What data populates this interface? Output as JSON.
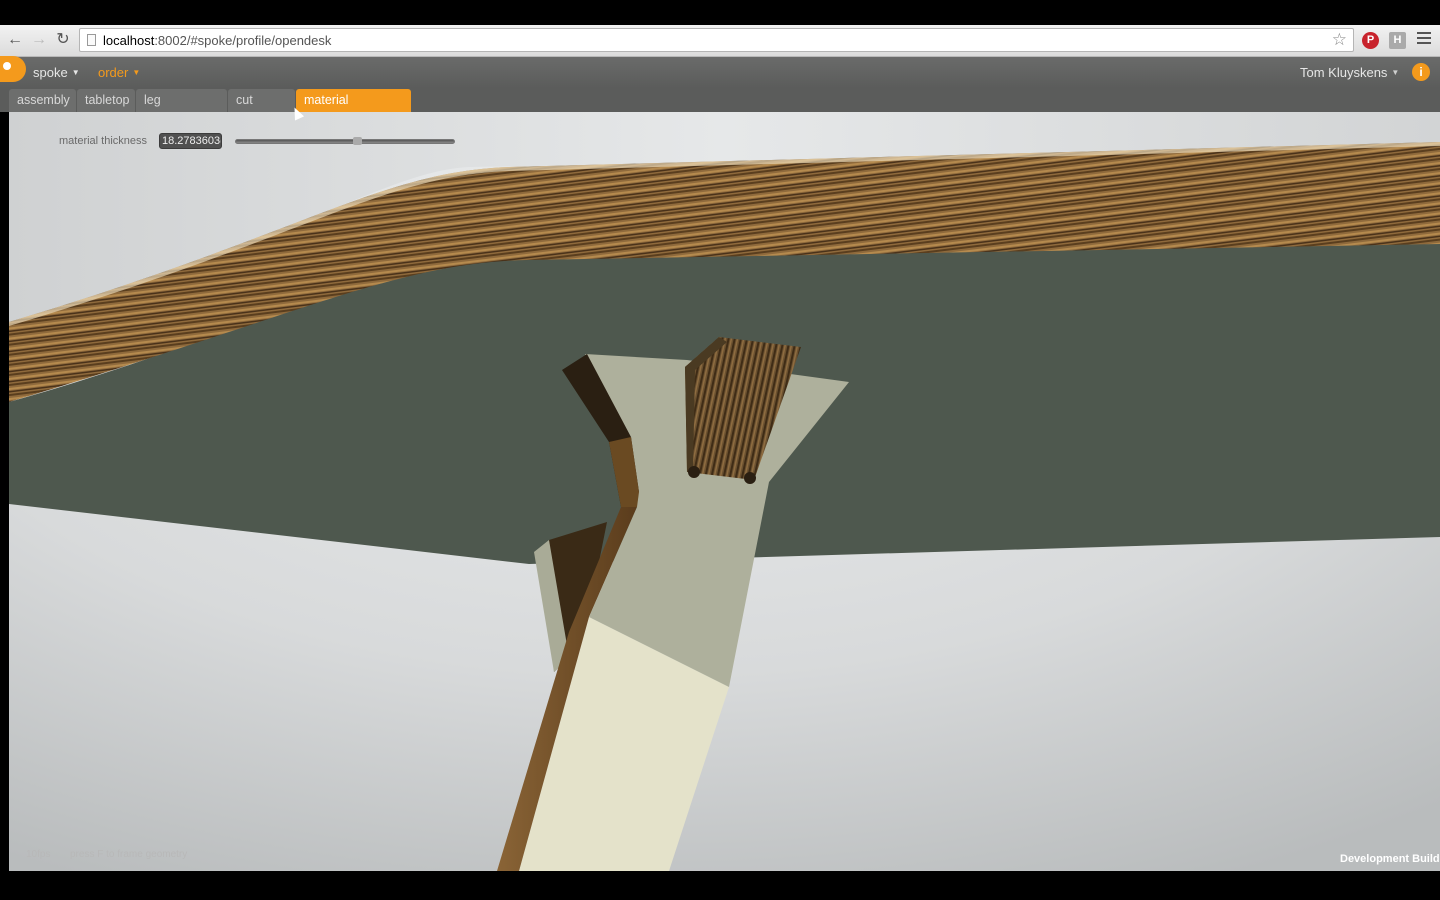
{
  "browser": {
    "url_host": "localhost",
    "url_rest": ":8002/#spoke/profile/opendesk",
    "ext_pinterest_letter": "P",
    "ext_h_letter": "H"
  },
  "app_bar": {
    "menu_spoke": "spoke",
    "menu_order": "order",
    "user_name": "Tom Kluyskens",
    "info_symbol": "i"
  },
  "tabs": [
    {
      "label": "assembly",
      "active": false
    },
    {
      "label": "tabletop",
      "active": false
    },
    {
      "label": "leg placement",
      "active": false
    },
    {
      "label": "cut layout",
      "active": false
    },
    {
      "label": "material thickness",
      "active": true
    }
  ],
  "parameters": {
    "label": "material thickness",
    "value": "18.2783603(",
    "slider_fraction": 0.56
  },
  "footer": {
    "fps": "10fps",
    "hint": "press F to frame geometry",
    "build": "Development Build"
  },
  "colors": {
    "accent": "#f49a1c",
    "wood_dark": "#5a3e1e",
    "wood_light": "#b58a4e",
    "tabletop_underside": "#4e584e",
    "leg_face": "#e2e0c8",
    "leg_shadow": "#aeb09c",
    "floor": "#d8dadb"
  },
  "icons": {
    "back": "back-arrow-icon",
    "forward": "forward-arrow-icon",
    "reload": "reload-icon",
    "page": "page-icon",
    "star": "star-icon",
    "menu": "hamburger-menu-icon",
    "info": "info-icon"
  }
}
